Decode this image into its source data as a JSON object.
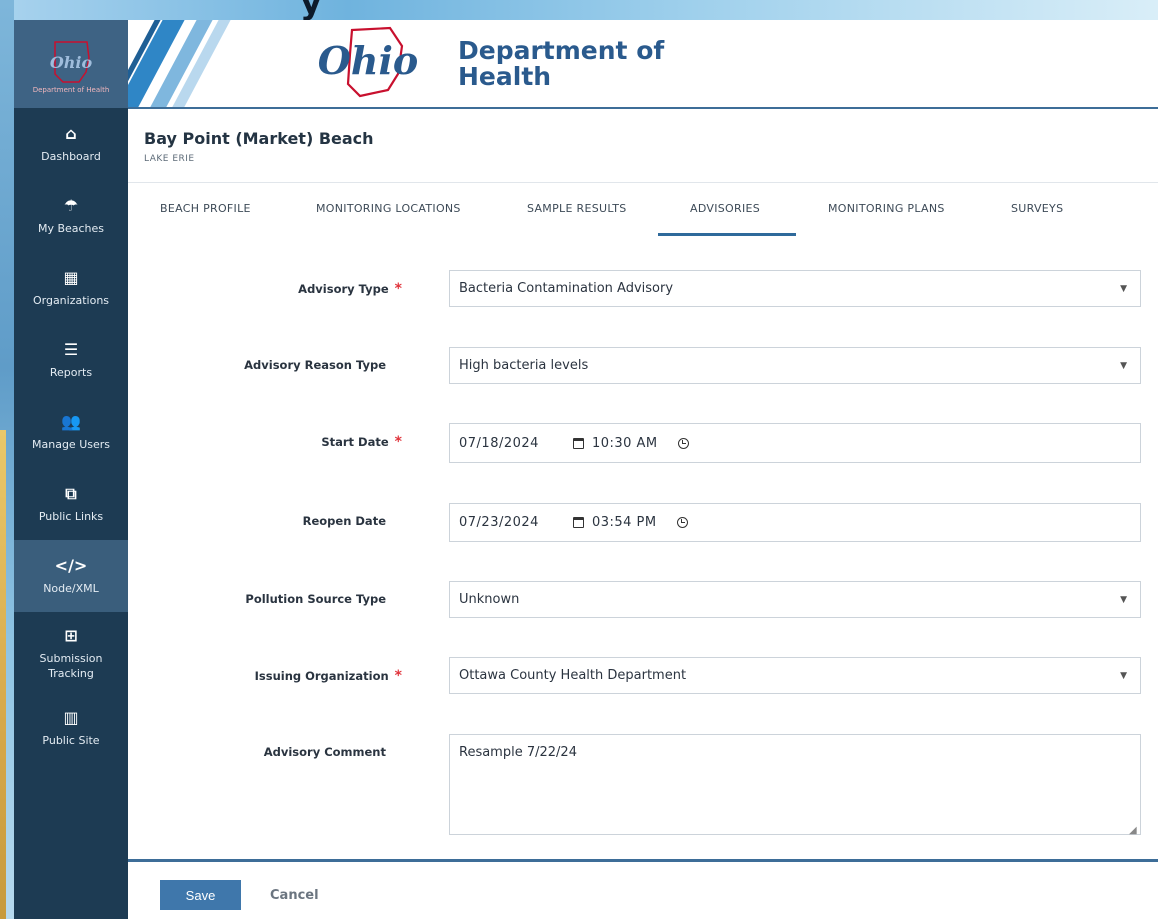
{
  "page_title_fragment": "y",
  "sidebar": {
    "logo_caption": "Department of Health",
    "items": [
      {
        "label": "Dashboard",
        "icon": "home-icon",
        "glyph": "⌂"
      },
      {
        "label": "My Beaches",
        "icon": "umbrella-icon",
        "glyph": "☂"
      },
      {
        "label": "Organizations",
        "icon": "building-icon",
        "glyph": "▦"
      },
      {
        "label": "Reports",
        "icon": "sliders-icon",
        "glyph": "☰"
      },
      {
        "label": "Manage Users",
        "icon": "users-icon",
        "glyph": "👥"
      },
      {
        "label": "Public Links",
        "icon": "external-link-icon",
        "glyph": "⧉"
      },
      {
        "label": "Node/XML",
        "icon": "code-icon",
        "glyph": "</>",
        "active": true
      },
      {
        "label": "Submission Tracking",
        "icon": "table-icon",
        "glyph": "⊞"
      },
      {
        "label": "Public Site",
        "icon": "map-icon",
        "glyph": "▥"
      }
    ]
  },
  "header": {
    "dept_line1": "Department of",
    "dept_line2": "Health",
    "logo_word": "Ohio"
  },
  "beach": {
    "name": "Bay Point (Market) Beach",
    "lake": "LAKE ERIE"
  },
  "tabs": [
    {
      "label": "BEACH PROFILE"
    },
    {
      "label": "MONITORING LOCATIONS"
    },
    {
      "label": "SAMPLE RESULTS"
    },
    {
      "label": "ADVISORIES",
      "active": true
    },
    {
      "label": "MONITORING PLANS"
    },
    {
      "label": "SURVEYS"
    }
  ],
  "form": {
    "advisory_type": {
      "label": "Advisory Type",
      "value": "Bacteria Contamination Advisory"
    },
    "reason_type": {
      "label": "Advisory Reason Type",
      "value": "High bacteria levels"
    },
    "start_date": {
      "label": "Start Date",
      "date": "07/18/2024",
      "time": "10:30 AM"
    },
    "reopen_date": {
      "label": "Reopen Date",
      "date": "07/23/2024",
      "time": "03:54 PM"
    },
    "pollution_source": {
      "label": "Pollution Source Type",
      "value": "Unknown"
    },
    "issuing_org": {
      "label": "Issuing Organization",
      "value": "Ottawa County Health Department"
    },
    "comment": {
      "label": "Advisory Comment",
      "value": "Resample 7/22/24"
    }
  },
  "actions": {
    "save_label": "Save",
    "cancel_label": "Cancel"
  },
  "colors": {
    "sidebar_bg": "#1d3b53",
    "accent_blue": "#3f77ab",
    "required_red": "#e0343c",
    "brand_red": "#c8102e"
  }
}
